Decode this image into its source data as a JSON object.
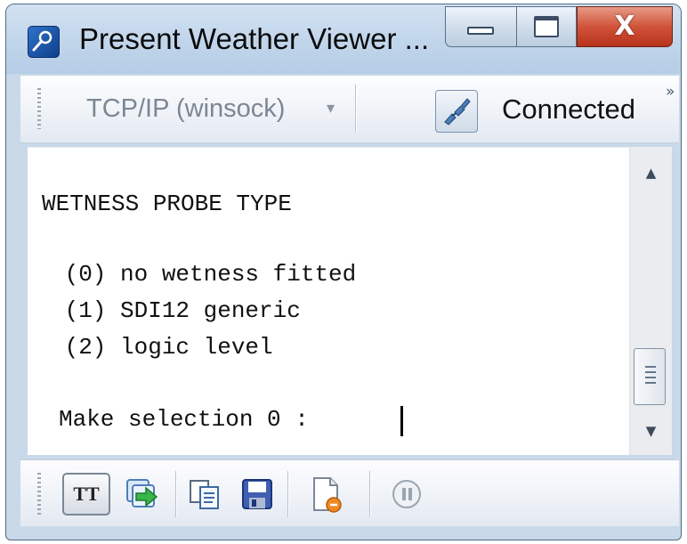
{
  "window": {
    "title": "Present Weather Viewer ...",
    "app_icon": "telescope-icon",
    "controls": {
      "minimize_icon": "minimize-icon",
      "maximize_icon": "maximize-icon",
      "close_icon": "close-icon",
      "close_glyph": "X"
    }
  },
  "toolbar_top": {
    "connection_type": "TCP/IP (winsock)",
    "dropdown_glyph": "▾",
    "connection_icon": "connection-plug-icon",
    "status_label": "Connected",
    "overflow_glyph": "»"
  },
  "terminal": {
    "lines": [
      "WETNESS PROBE TYPE",
      " (0) no wetness fitted",
      " (1) SDI12 generic",
      " (2) logic level",
      "Make selection 0 : "
    ]
  },
  "scrollbar": {
    "up_glyph": "▲",
    "down_glyph": "▼"
  },
  "toolbar_bottom": {
    "buttons": [
      {
        "label": "TT",
        "icon": "terminal-text-icon"
      },
      {
        "icon": "send-arrow-icon"
      },
      {
        "icon": "copy-icon"
      },
      {
        "icon": "save-icon"
      },
      {
        "icon": "log-file-icon"
      },
      {
        "icon": "pause-icon"
      }
    ]
  },
  "colors": {
    "frame": "#c9d9ea",
    "close_button": "#c8452f",
    "status_text": "#111111",
    "disabled_text": "#7c8794"
  }
}
